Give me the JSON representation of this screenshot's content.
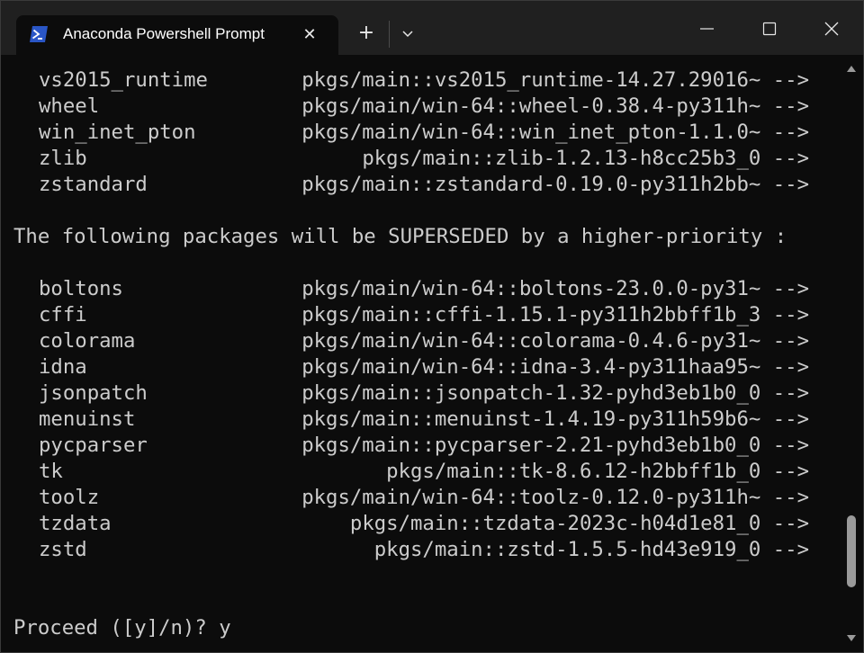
{
  "tab": {
    "title": "Anaconda Powershell Prompt",
    "close_glyph": "✕",
    "icon": "powershell-icon"
  },
  "toolbar": {
    "new_tab_glyph": "+",
    "dropdown_icon": "chevron-down-icon"
  },
  "window_controls": {
    "minimize_icon": "minimize-icon",
    "maximize_icon": "maximize-icon",
    "close_icon": "close-icon"
  },
  "colors": {
    "terminal_bg": "#0c0c0c",
    "text": "#cccccc",
    "titlebar": "#202020",
    "powershell_blue": "#2a56c6"
  },
  "terminal": {
    "updated_tail": [
      {
        "name": "vs2015_runtime",
        "spec": "pkgs/main::vs2015_runtime-14.27.29016~ -->"
      },
      {
        "name": "wheel",
        "spec": "pkgs/main/win-64::wheel-0.38.4-py311h~ -->"
      },
      {
        "name": "win_inet_pton",
        "spec": "pkgs/main/win-64::win_inet_pton-1.1.0~ -->"
      },
      {
        "name": "zlib",
        "spec": "pkgs/main::zlib-1.2.13-h8cc25b3_0 -->"
      },
      {
        "name": "zstandard",
        "spec": "pkgs/main::zstandard-0.19.0-py311h2bb~ -->"
      }
    ],
    "superseded_header": "The following packages will be SUPERSEDED by a higher-priority :",
    "superseded": [
      {
        "name": "boltons",
        "spec": "pkgs/main/win-64::boltons-23.0.0-py31~ -->"
      },
      {
        "name": "cffi",
        "spec": "pkgs/main::cffi-1.15.1-py311h2bbff1b_3 -->"
      },
      {
        "name": "colorama",
        "spec": "pkgs/main/win-64::colorama-0.4.6-py31~ -->"
      },
      {
        "name": "idna",
        "spec": "pkgs/main/win-64::idna-3.4-py311haa95~ -->"
      },
      {
        "name": "jsonpatch",
        "spec": "pkgs/main::jsonpatch-1.32-pyhd3eb1b0_0 -->"
      },
      {
        "name": "menuinst",
        "spec": "pkgs/main::menuinst-1.4.19-py311h59b6~ -->"
      },
      {
        "name": "pycparser",
        "spec": "pkgs/main::pycparser-2.21-pyhd3eb1b0_0 -->"
      },
      {
        "name": "tk",
        "spec": "pkgs/main::tk-8.6.12-h2bbff1b_0 -->"
      },
      {
        "name": "toolz",
        "spec": "pkgs/main/win-64::toolz-0.12.0-py311h~ -->"
      },
      {
        "name": "tzdata",
        "spec": "pkgs/main::tzdata-2023c-h04d1e81_0 -->"
      },
      {
        "name": "zstd",
        "spec": "pkgs/main::zstd-1.5.5-hd43e919_0 -->"
      }
    ],
    "prompt": "Proceed ([y]/n)? y"
  }
}
